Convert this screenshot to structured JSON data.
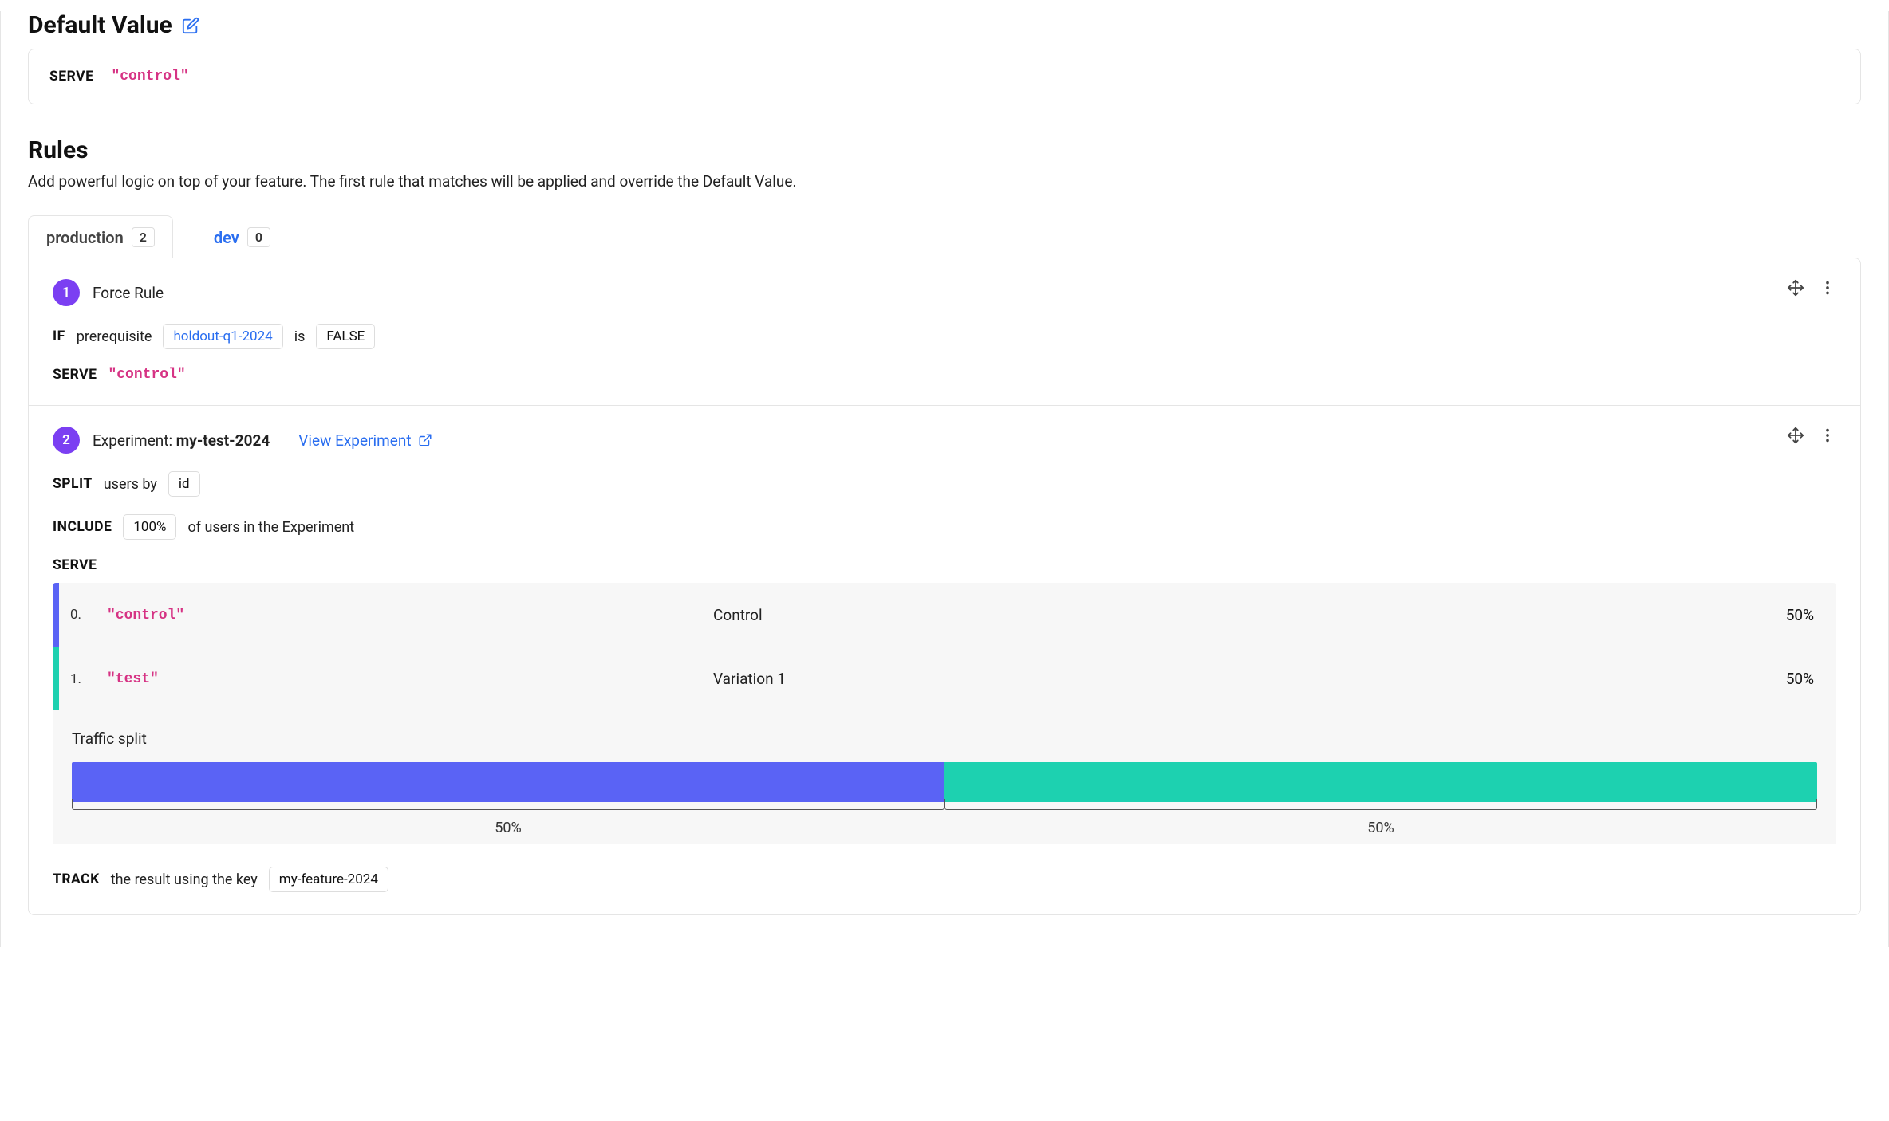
{
  "default_value": {
    "title": "Default Value",
    "serve_kw": "SERVE",
    "value": "\"control\""
  },
  "rules_section": {
    "title": "Rules",
    "description": "Add powerful logic on top of your feature. The first rule that matches will be applied and override the Default Value."
  },
  "tabs": [
    {
      "label": "production",
      "count": "2",
      "active": true
    },
    {
      "label": "dev",
      "count": "0",
      "active": false
    }
  ],
  "rules": [
    {
      "num": "1",
      "title_prefix": "Force Rule",
      "if_kw": "IF",
      "if_text": "prerequisite",
      "prereq_chip": "holdout-q1-2024",
      "is_text": "is",
      "false_chip": "FALSE",
      "serve_kw": "SERVE",
      "serve_value": "\"control\""
    },
    {
      "num": "2",
      "title_prefix": "Experiment: ",
      "title_bold": "my-test-2024",
      "view_link": "View Experiment",
      "split_kw": "SPLIT",
      "split_text": "users by",
      "split_chip": "id",
      "include_kw": "INCLUDE",
      "include_chip": "100%",
      "include_text": "of users in the Experiment",
      "serve_kw": "SERVE",
      "variations": [
        {
          "idx": "0.",
          "key": "\"control\"",
          "name": "Control",
          "pct": "50%",
          "color": "#5a63f5"
        },
        {
          "idx": "1.",
          "key": "\"test\"",
          "name": "Variation 1",
          "pct": "50%",
          "color": "#1dd1b0"
        }
      ],
      "traffic": {
        "label": "Traffic split",
        "segments": [
          {
            "pct": "50%",
            "width": 50,
            "color": "#5a63f5"
          },
          {
            "pct": "50%",
            "width": 50,
            "color": "#1dd1b0"
          }
        ]
      },
      "track_kw": "TRACK",
      "track_text": "the result using the key",
      "track_chip": "my-feature-2024"
    }
  ]
}
